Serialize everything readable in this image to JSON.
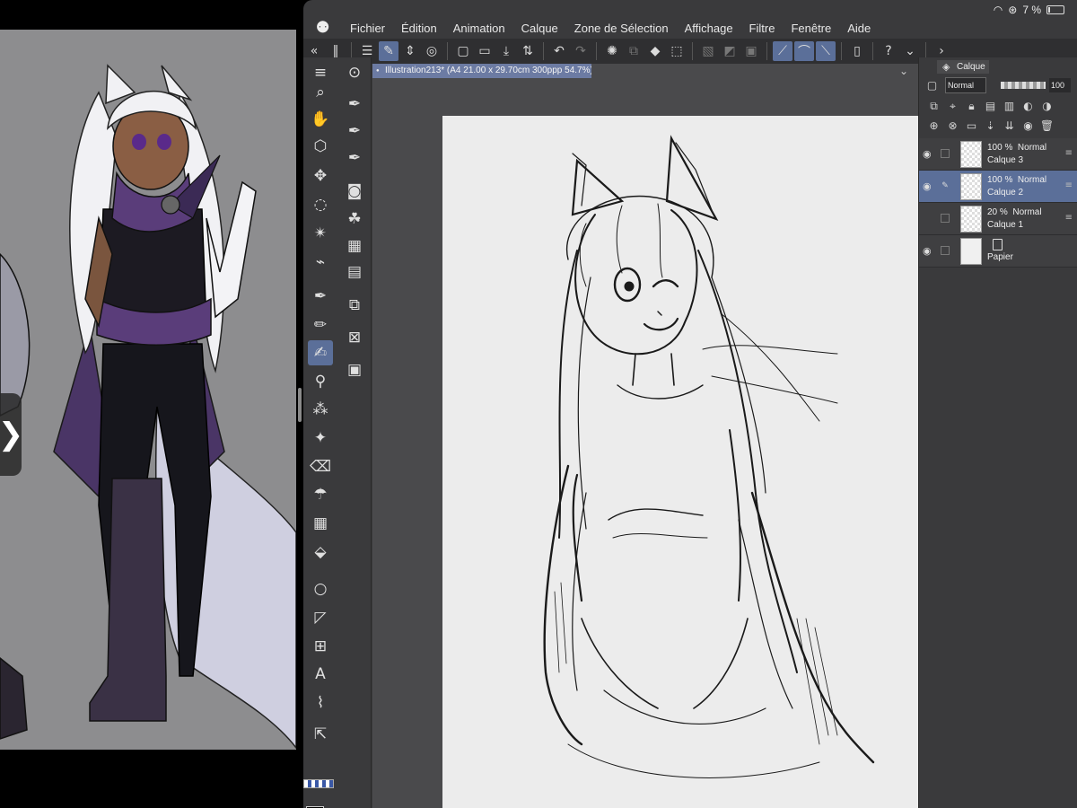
{
  "status_bar": {
    "battery": "7 %"
  },
  "menu": {
    "logo": "⚉",
    "items": [
      "Fichier",
      "Édition",
      "Animation",
      "Calque",
      "Zone de Sélection",
      "Affichage",
      "Filtre",
      "Fenêtre",
      "Aide"
    ]
  },
  "document": {
    "tab_title": "Illustration213* (A4 21.00 x 29.70cm 300ppp 54.7%)"
  },
  "layer_panel": {
    "tab_label": "Calque",
    "blend_mode": "Normal",
    "opacity": "100",
    "layers": [
      {
        "opacity": "100 %",
        "mode": "Normal",
        "name": "Calque 3",
        "visible": true,
        "selected": false
      },
      {
        "opacity": "100 %",
        "mode": "Normal",
        "name": "Calque 2",
        "visible": true,
        "selected": true
      },
      {
        "opacity": "20 %",
        "mode": "Normal",
        "name": "Calque 1",
        "visible": false,
        "selected": false
      },
      {
        "opacity": "",
        "mode": "",
        "name": "Papier",
        "visible": true,
        "selected": false
      }
    ]
  },
  "colors": {
    "app_bg": "#3a3a3c",
    "accent": "#5b6f99",
    "reference_bg": "#8d8d8f",
    "paper": "#ececec"
  }
}
